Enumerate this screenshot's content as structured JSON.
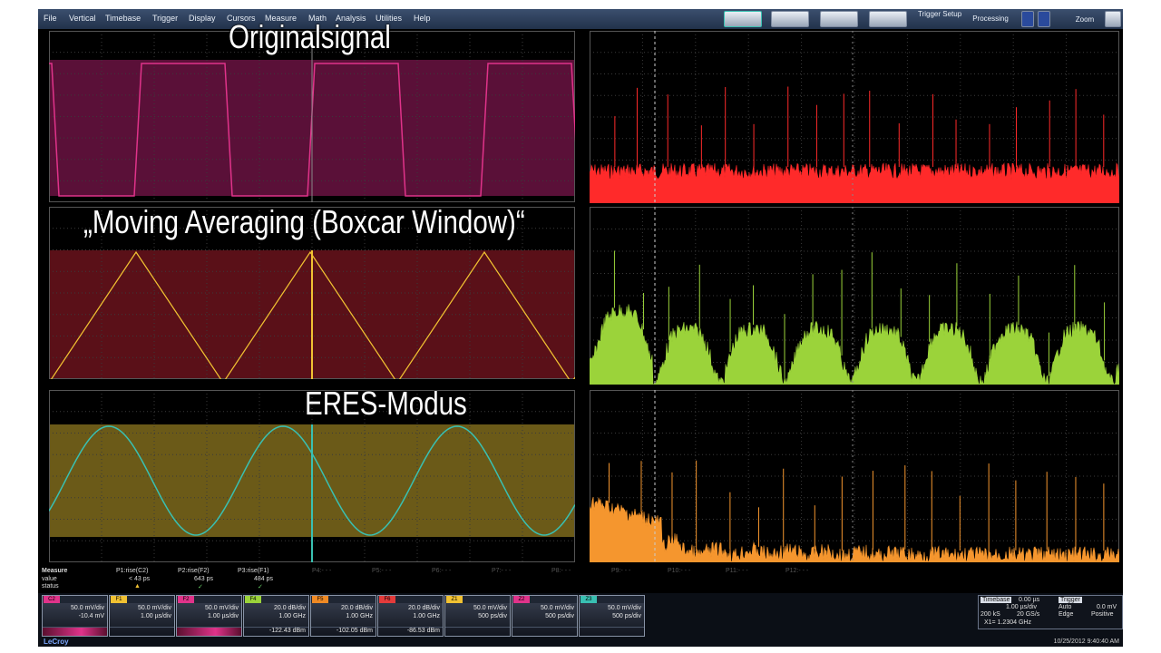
{
  "menu": [
    "File",
    "Vertical",
    "Timebase",
    "Trigger",
    "Display",
    "Cursors",
    "Measure",
    "Math",
    "Analysis",
    "Utilities",
    "Help"
  ],
  "toolbar": {
    "trigger_setup": "Trigger Setup",
    "processing": "Processing",
    "zoom": "Zoom"
  },
  "overlays": {
    "original": "Originalsignal",
    "moving_avg": "„Moving Averaging (Boxcar Window)“",
    "eres": "ERES-Modus"
  },
  "measure": {
    "label": "Measure",
    "rows": [
      "value",
      "status"
    ],
    "params": [
      {
        "name": "P1:rise(C2)",
        "value": "< 43 ps"
      },
      {
        "name": "P2:rise(F2)",
        "value": "643 ps"
      },
      {
        "name": "P3:rise(F1)",
        "value": "484 ps"
      }
    ],
    "inactive": [
      "P4:- - -",
      "P5:- - -",
      "P6:- - -",
      "P7:- - -",
      "P8:- - -",
      "P9:- - -",
      "P10:- - -",
      "P11:- - -",
      "P12:- - -"
    ]
  },
  "descriptors": [
    {
      "tag": "C2",
      "color": "#e0338a",
      "line1": "50.0 mV/div",
      "line2": "-10.4 mV"
    },
    {
      "tag": "F1",
      "color": "#f1c232",
      "line1": "50.0 mV/div",
      "line2": "1.00 µs/div"
    },
    {
      "tag": "F2",
      "color": "#e0338a",
      "line1": "50.0 mV/div",
      "line2": "1.00 µs/div"
    },
    {
      "tag": "F4",
      "color": "#9bd33a",
      "line1": "20.0 dB/div",
      "line2": "1.00 GHz",
      "line3": "-122.43 dBm"
    },
    {
      "tag": "F5",
      "color": "#f08a24",
      "line1": "20.0 dB/div",
      "line2": "1.00 GHz",
      "line3": "-102.05 dBm"
    },
    {
      "tag": "F6",
      "color": "#e43b3b",
      "line1": "20.0 dB/div",
      "line2": "1.00 GHz",
      "line3": "-86.53 dBm"
    },
    {
      "tag": "Z1",
      "color": "#f1c232",
      "line1": "50.0 mV/div",
      "line2": "500 ps/div"
    },
    {
      "tag": "Z2",
      "color": "#e0338a",
      "line1": "50.0 mV/div",
      "line2": "500 ps/div"
    },
    {
      "tag": "Z3",
      "color": "#39c0b2",
      "line1": "50.0 mV/div",
      "line2": "500 ps/div"
    }
  ],
  "timebase": {
    "label": "Timebase",
    "delay": "0.00 µs",
    "per_div": "1.00 µs/div",
    "samples": "200 kS",
    "rate": "20 GS/s",
    "x_readout": "X1= 1.2304 GHz"
  },
  "trigger": {
    "label": "Trigger",
    "mode": "Auto",
    "level": "0.0 mV",
    "type": "Edge",
    "slope": "Positive"
  },
  "datetime": "10/25/2012 9:40:40 AM",
  "logo": "LeCroy",
  "colors": {
    "magenta": "#e0338a",
    "yellow": "#f1c232",
    "teal": "#39c0b2",
    "red": "#ff2a2a",
    "green": "#9bd33a",
    "orange": "#f5962e"
  }
}
